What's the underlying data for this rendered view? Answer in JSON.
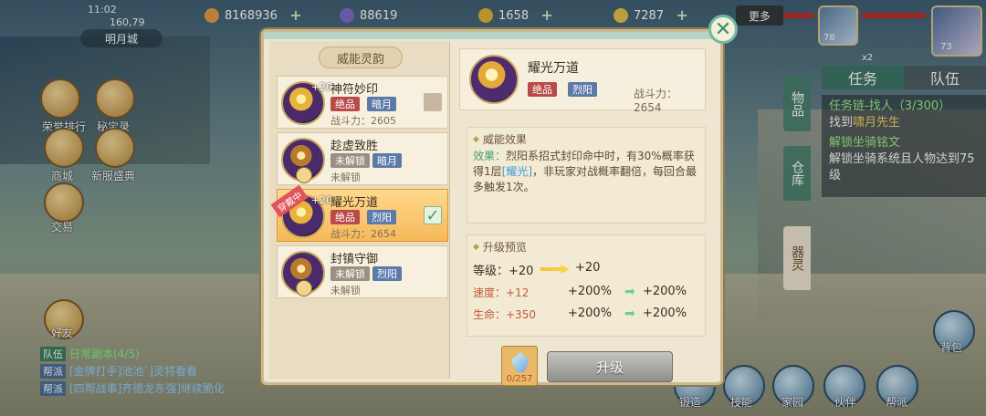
{
  "status": {
    "time": "11:02",
    "coords": "160,79",
    "city": "明月城"
  },
  "resources": [
    {
      "icon": "coin-icon",
      "value": "8168936",
      "color": "#e59b48"
    },
    {
      "icon": "jade-icon",
      "value": "88619",
      "color": "#7e6ec9"
    },
    {
      "icon": "gold-bag-icon",
      "value": "1658",
      "color": "#e2b23a"
    },
    {
      "icon": "ingot-icon",
      "value": "7287",
      "color": "#e8c04a"
    }
  ],
  "top_right": {
    "more_label": "更多",
    "lv_small": "78",
    "lv_big": "73",
    "multiplier": "x2"
  },
  "right_panel": {
    "tabs": [
      "任务",
      "队伍"
    ],
    "quest_title": "任务链-找人（3/300）",
    "quest_target_prefix": "找到",
    "quest_target_npc": "啸月先生",
    "quest2_title": "解锁坐骑铭文",
    "quest2_desc": "解锁坐骑系统且人物达到75级"
  },
  "side_tabs": [
    "物品",
    "仓库",
    "器灵"
  ],
  "left_menu": [
    {
      "label": "荣誉排行"
    },
    {
      "label": "秘宝录"
    },
    {
      "label": "商城"
    },
    {
      "label": "新服盛典"
    },
    {
      "label": "交易"
    },
    {
      "label": "好友"
    }
  ],
  "chat": [
    {
      "tag": "队伍",
      "text": "日常副本(4/5)"
    },
    {
      "tag": "帮派",
      "text": "[金牌打手]池池`]灵将看看"
    },
    {
      "tag": "帮派",
      "text": "[四帮战事]齐德龙东强]继续脆化"
    }
  ],
  "bottom_buttons": [
    "锻造",
    "技能",
    "家园",
    "伙伴",
    "帮派",
    "背包"
  ],
  "modal": {
    "list_title": "威能灵韵",
    "items": [
      {
        "name": "神符妙印",
        "level": "+20",
        "grade": "绝品",
        "element": "暗月",
        "sub": "战斗力：2605",
        "locked": false,
        "equipped": false,
        "checked": false
      },
      {
        "name": "趁虚致胜",
        "level": "",
        "grade": "未解锁",
        "element": "暗月",
        "sub": "未解锁",
        "locked": true,
        "equipped": false,
        "checked": false
      },
      {
        "name": "耀光万道",
        "level": "+20",
        "grade": "绝品",
        "element": "烈阳",
        "sub": "战斗力：2654",
        "locked": false,
        "equipped": true,
        "checked": true,
        "equip_flag": "穿戴中"
      },
      {
        "name": "封镇守御",
        "level": "",
        "grade": "未解锁",
        "element": "烈阳",
        "sub": "未解锁",
        "locked": true,
        "equipped": false,
        "checked": false
      }
    ],
    "detail": {
      "name": "耀光万道",
      "grade": "绝品",
      "element": "烈阳",
      "power_label": "战斗力：2654",
      "effect_title": "威能效果",
      "effect_kw": "效果：",
      "effect_text_1": "烈阳系招式封印命中时，有30%概率获得1层",
      "effect_hl": "[耀光]",
      "effect_text_2": "，非玩家对战概率翻倍，每回合最多触发1次。",
      "upgrade_title": "升级预览",
      "level_label": "等级：+20",
      "level_next": "+20",
      "speed_label": "速度：+12",
      "speed_from": "+200%",
      "speed_to": "+200%",
      "life_label": "生命：+350",
      "life_from": "+200%",
      "life_to": "+200%",
      "material_count": "0/257",
      "upgrade_btn": "升级"
    }
  }
}
